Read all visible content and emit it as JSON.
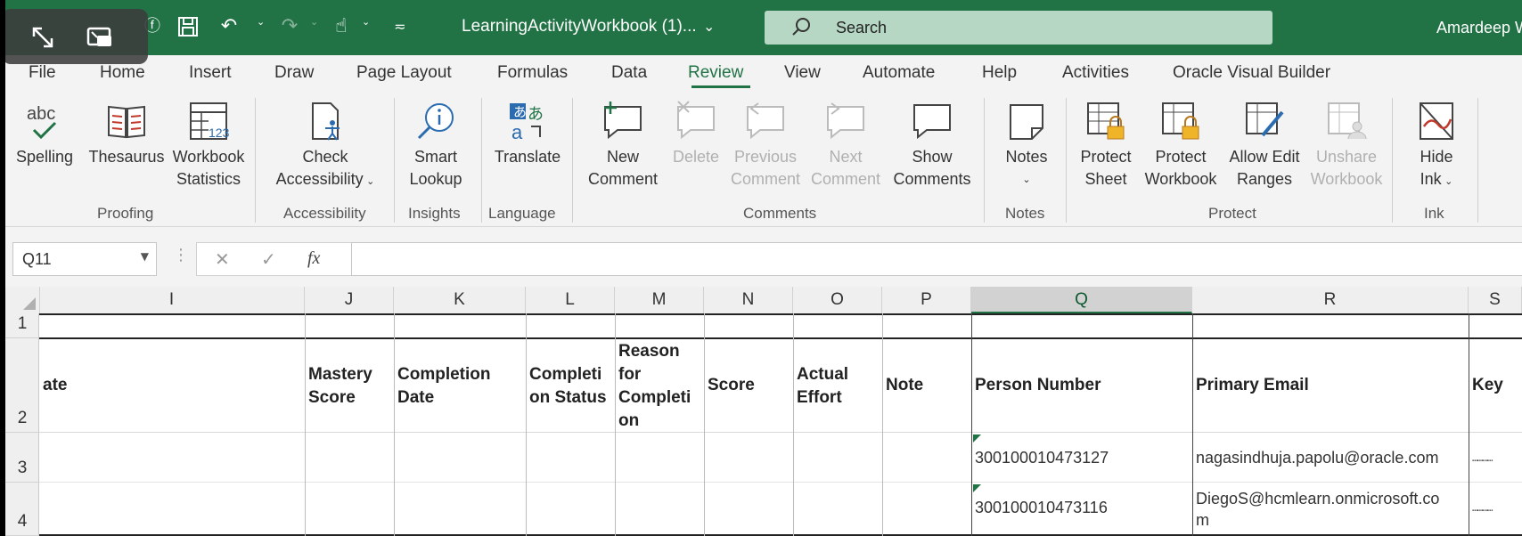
{
  "titlebar": {
    "doc_title": "LearningActivityWorkbook (1)...",
    "search_placeholder": "Search",
    "user_name": "Amardeep W"
  },
  "tabs": [
    "File",
    "Home",
    "Insert",
    "Draw",
    "Page Layout",
    "Formulas",
    "Data",
    "Review",
    "View",
    "Automate",
    "Help",
    "Activities",
    "Oracle Visual Builder"
  ],
  "active_tab": "Review",
  "ribbon": {
    "buttons": {
      "spelling": "Spelling",
      "thesaurus": "Thesaurus",
      "workbook_statistics_1": "Workbook",
      "workbook_statistics_2": "Statistics",
      "check_accessibility_1": "Check",
      "check_accessibility_2": "Accessibility",
      "smart_lookup_1": "Smart",
      "smart_lookup_2": "Lookup",
      "translate": "Translate",
      "new_comment_1": "New",
      "new_comment_2": "Comment",
      "delete": "Delete",
      "previous_comment_1": "Previous",
      "previous_comment_2": "Comment",
      "next_comment_1": "Next",
      "next_comment_2": "Comment",
      "show_comments_1": "Show",
      "show_comments_2": "Comments",
      "notes": "Notes",
      "protect_sheet_1": "Protect",
      "protect_sheet_2": "Sheet",
      "protect_workbook_1": "Protect",
      "protect_workbook_2": "Workbook",
      "allow_edit_1": "Allow Edit",
      "allow_edit_2": "Ranges",
      "unshare_1": "Unshare",
      "unshare_2": "Workbook",
      "hide_ink_1": "Hide",
      "hide_ink_2": "Ink",
      "abc_icon_text": "abc"
    },
    "groups": {
      "proofing": "Proofing",
      "accessibility": "Accessibility",
      "insights": "Insights",
      "language": "Language",
      "comments": "Comments",
      "notes": "Notes",
      "protect": "Protect",
      "ink": "Ink"
    }
  },
  "formula_bar": {
    "name_box": "Q11",
    "fx": "fx",
    "value": ""
  },
  "sheet": {
    "columns": [
      "I",
      "J",
      "K",
      "L",
      "M",
      "N",
      "O",
      "P",
      "Q",
      "R",
      "S"
    ],
    "selected_column": "Q",
    "rows": [
      "1",
      "2",
      "3",
      "4"
    ],
    "headers": {
      "I": "ate",
      "J": "Mastery\nScore",
      "K": "Completion\nDate",
      "L": "Completi\non Status",
      "M": "Reason\nfor\nCompleti\non",
      "N": "Score",
      "O": "Actual\nEffort",
      "P": "Note",
      "Q": "Person Number",
      "R": "Primary Email",
      "S": "Key"
    },
    "data": [
      {
        "person_number": "300100010473127",
        "primary_email": "nagasindhuja.papolu@oracle.com",
        "key": "…………"
      },
      {
        "person_number": "300100010473116",
        "primary_email": "DiegoS@hcmlearn.onmicrosoft.co\nm",
        "key": "…………"
      }
    ]
  },
  "colors": {
    "excel_green": "#217346",
    "search_bg": "#b6d7c3"
  }
}
